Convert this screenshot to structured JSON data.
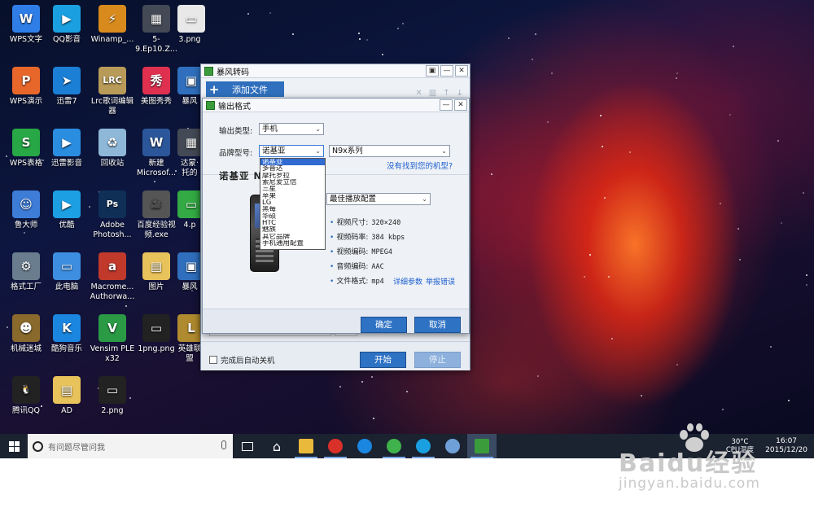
{
  "desktop": {
    "icons": [
      {
        "label": "WPS文字",
        "icon": "wps-writer-icon",
        "color": "#2f7ee8",
        "glyph": "W"
      },
      {
        "label": "QQ影音",
        "icon": "qq-player-icon",
        "color": "#1aa0e0",
        "glyph": "▶"
      },
      {
        "label": "Winamp_...",
        "icon": "winamp-icon",
        "color": "#d98a1d",
        "glyph": "⚡"
      },
      {
        "label": "5-9.Ep10.Z...",
        "icon": "video-file-icon",
        "color": "#444a55",
        "glyph": "▦"
      },
      {
        "label": "3.png",
        "icon": "image-file-icon",
        "color": "#e8e8e8",
        "glyph": "▭"
      },
      {
        "label": "WPS演示",
        "icon": "wps-presentation-icon",
        "color": "#e7672a",
        "glyph": "P"
      },
      {
        "label": "迅雷7",
        "icon": "thunder-icon",
        "color": "#1b7fd6",
        "glyph": "➤"
      },
      {
        "label": "Lrc歌词编辑器",
        "icon": "lrc-editor-icon",
        "color": "#b89b58",
        "glyph": "LRC"
      },
      {
        "label": "美图秀秀",
        "icon": "meitu-icon",
        "color": "#e0304f",
        "glyph": "秀"
      },
      {
        "label": "暴风",
        "icon": "baofeng-icon",
        "color": "#2f6fbd",
        "glyph": "▣"
      },
      {
        "label": "WPS表格",
        "icon": "wps-spreadsheet-icon",
        "color": "#27a745",
        "glyph": "S"
      },
      {
        "label": "迅雷影音",
        "icon": "thunder-player-icon",
        "color": "#2a8de0",
        "glyph": "▶"
      },
      {
        "label": "回收站",
        "icon": "recycle-bin-icon",
        "color": "#8fb8d8",
        "glyph": "♻"
      },
      {
        "label": "新建 Microsof...",
        "icon": "word-doc-icon",
        "color": "#2b579a",
        "glyph": "W"
      },
      {
        "label": "达蒙·托的",
        "icon": "video-file-icon",
        "color": "#444a55",
        "glyph": "▦"
      },
      {
        "label": "鲁大师",
        "icon": "ludashi-icon",
        "color": "#3d7dd8",
        "glyph": "☺"
      },
      {
        "label": "优酷",
        "icon": "youku-icon",
        "color": "#1d9fe3",
        "glyph": "▶"
      },
      {
        "label": "Adobe Photosh...",
        "icon": "photoshop-icon",
        "color": "#0f2f57",
        "glyph": "Ps"
      },
      {
        "label": "百度经验视频.exe",
        "icon": "video-exe-icon",
        "color": "#555",
        "glyph": "🎥"
      },
      {
        "label": "4.p",
        "icon": "image-file-icon",
        "color": "#3a4",
        "glyph": "▭"
      },
      {
        "label": "格式工厂",
        "icon": "format-factory-icon",
        "color": "#6a7d8e",
        "glyph": "⚙"
      },
      {
        "label": "此电脑",
        "icon": "computer-icon",
        "color": "#3d8ee0",
        "glyph": "▭"
      },
      {
        "label": "Macrome... Authorwa...",
        "icon": "macromedia-icon",
        "color": "#c0392b",
        "glyph": "a"
      },
      {
        "label": "图片",
        "icon": "folder-icon",
        "color": "#e8c25a",
        "glyph": "▤"
      },
      {
        "label": "暴风",
        "icon": "baofeng-icon",
        "color": "#2f6fbd",
        "glyph": "▣"
      },
      {
        "label": "机械迷城",
        "icon": "machinarium-icon",
        "color": "#8a6a2c",
        "glyph": "☻"
      },
      {
        "label": "酷狗音乐",
        "icon": "kugou-icon",
        "color": "#1b86e0",
        "glyph": "K"
      },
      {
        "label": "Vensim PLE x32",
        "icon": "vensim-icon",
        "color": "#2a9a45",
        "glyph": "V"
      },
      {
        "label": "1png.png",
        "icon": "image-file-icon",
        "color": "#222",
        "glyph": "▭"
      },
      {
        "label": "英雄联盟",
        "icon": "lol-icon",
        "color": "#b08a2e",
        "glyph": "L"
      },
      {
        "label": "腾讯QQ",
        "icon": "qq-icon",
        "color": "#222",
        "glyph": "🐧"
      },
      {
        "label": "AD",
        "icon": "folder-icon",
        "color": "#e8c25a",
        "glyph": "▤"
      },
      {
        "label": "2.png",
        "icon": "image-file-icon",
        "color": "#222",
        "glyph": "▭"
      }
    ]
  },
  "main_window": {
    "title": "暴风转码",
    "add_file_label": "添加文件",
    "auto_shutdown_label": "完成后自动关机",
    "start_label": "开始",
    "stop_label": "停止"
  },
  "output_dialog": {
    "title": "输出格式",
    "output_type_label": "输出类型:",
    "output_type_value": "手机",
    "brand_label": "品牌型号:",
    "brand_value": "诺基亚",
    "series_value": "N9x系列",
    "not_found_link": "没有找到您的机型?",
    "model_heading": "诺基亚 N",
    "quality_value": "最佳播放配置",
    "specs": [
      {
        "key": "视频尺寸:",
        "value": "320×240"
      },
      {
        "key": "视频码率:",
        "value": "384 kbps"
      },
      {
        "key": "视频编码:",
        "value": "MPEG4"
      },
      {
        "key": "音频编码:",
        "value": "AAC"
      },
      {
        "key": "文件格式:",
        "value": "mp4"
      }
    ],
    "detail_link": "详细参数",
    "report_link": "举报错误",
    "ok_label": "确定",
    "cancel_label": "取消",
    "brand_options": [
      "诺基亚",
      "多普达",
      "摩托罗拉",
      "索尼爱立信",
      "三星",
      "苹果",
      "LG",
      "黑莓",
      "华硕",
      "HTC",
      "魅族",
      "其它品牌",
      "手机通用配置"
    ],
    "brand_selected_index": 0
  },
  "taskbar": {
    "search_placeholder": "有问题尽管问我",
    "temperature": "30°C",
    "temperature_label": "CPU温度",
    "time": "16:07",
    "date": "2015/12/20",
    "pinned": [
      "task-view-icon",
      "home-icon",
      "file-explorer-icon",
      "netease-music-icon",
      "kugou-icon",
      "iqiyi-icon",
      "qq-player-icon",
      "paint-icon",
      "baofeng-icon"
    ]
  },
  "watermark": {
    "brand": "Baidu经验",
    "url": "jingyan.baidu.com"
  }
}
